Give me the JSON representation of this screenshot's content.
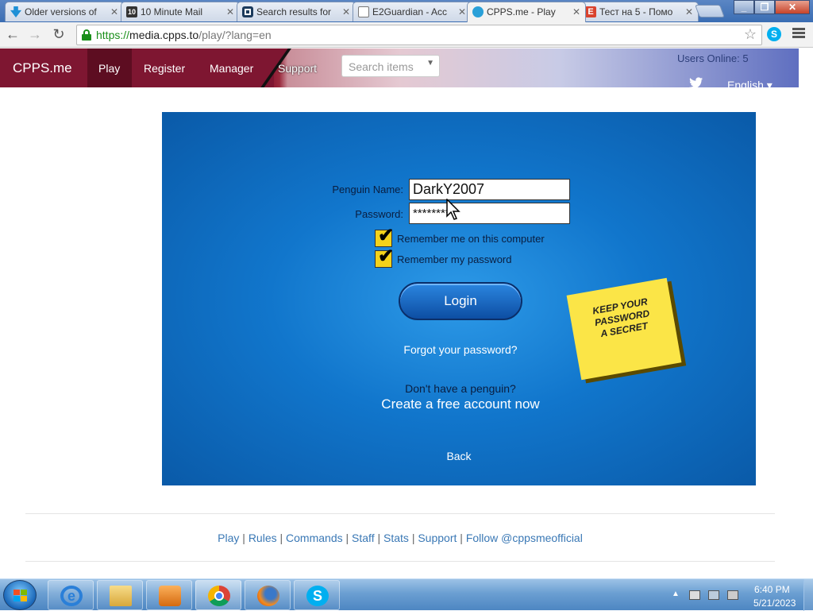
{
  "browser": {
    "tabs": [
      {
        "title": "Older versions of",
        "favicon_color": "#1e90d6"
      },
      {
        "title": "10 Minute Mail",
        "favicon_color": "#333333"
      },
      {
        "title": "Search results for",
        "favicon_color": "#1b3a5c"
      },
      {
        "title": "E2Guardian - Acc",
        "favicon_color": "#ffffff"
      },
      {
        "title": "CPPS.me - Play",
        "favicon_color": "#2aa0d8",
        "active": true
      },
      {
        "title": "Тест на 5 - Помо",
        "favicon_color": "#d9432e"
      }
    ],
    "url": {
      "scheme": "https://",
      "host": "media.cpps.to",
      "path": "/play/?lang=en"
    }
  },
  "site": {
    "brand": "CPPS.me",
    "nav": [
      "Play",
      "Register",
      "Manager",
      "Support"
    ],
    "active_nav": "Play",
    "search_placeholder": "Search items",
    "users_online": "Users Online: 5",
    "language": "English ▾",
    "accent": "#7e1631"
  },
  "login": {
    "penguin_name_label": "Penguin Name:",
    "penguin_name_value": "DarkY2007",
    "password_label": "Password:",
    "password_value": "********",
    "remember_me": {
      "label": "Remember me on this computer",
      "checked": true
    },
    "remember_password": {
      "label": "Remember my password",
      "checked": true
    },
    "login_button": "Login",
    "forgot": "Forgot your password?",
    "no_penguin": "Don't have a penguin?",
    "create": "Create a free account now",
    "back": "Back",
    "sticky_note": [
      "KEEP YOUR",
      "PASSWORD",
      "A SECRET"
    ]
  },
  "footer": {
    "links": [
      "Play",
      "Rules",
      "Commands",
      "Staff",
      "Stats",
      "Support",
      "Follow @cppsmeofficial"
    ]
  },
  "taskbar": {
    "apps": [
      "internet-explorer",
      "windows-explorer",
      "media-player",
      "chrome",
      "firefox",
      "skype"
    ],
    "time": "6:40 PM",
    "date": "5/21/2023"
  }
}
